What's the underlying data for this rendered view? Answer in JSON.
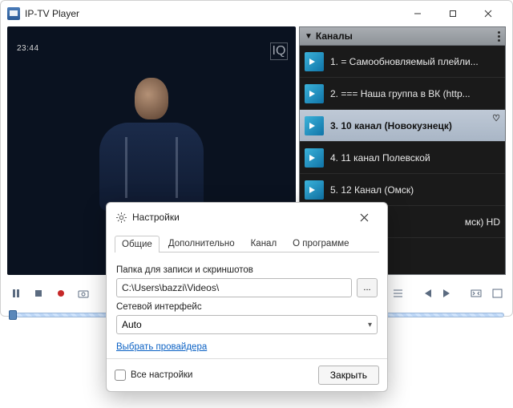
{
  "window": {
    "title": "IP-TV Player"
  },
  "player": {
    "timestamp": "23:44",
    "watermark": "IQ"
  },
  "sidebar": {
    "header": "Каналы",
    "channels": [
      {
        "label": "1. = Самообновляемый плейли...",
        "selected": false
      },
      {
        "label": "2. === Наша группа в ВК (http...",
        "selected": false
      },
      {
        "label": "3. 10 канал (Новокузнецк)",
        "selected": true
      },
      {
        "label": "4. 11 канал Полевской",
        "selected": false
      },
      {
        "label": "5. 12 Канал (Омск)",
        "selected": false
      },
      {
        "label": "",
        "suffix": "мск) HD",
        "selected": false
      }
    ]
  },
  "settings": {
    "title": "Настройки",
    "tabs": {
      "general": "Общие",
      "advanced": "Дополнительно",
      "channel": "Канал",
      "about": "О программе"
    },
    "record_path_label": "Папка для записи и скриншотов",
    "record_path_value": "C:\\Users\\bazzi\\Videos\\",
    "net_iface_label": "Сетевой интерфейс",
    "net_iface_value": "Auto",
    "choose_provider": "Выбрать провайдера",
    "all_settings": "Все настройки",
    "close": "Закрыть",
    "browse": "..."
  }
}
